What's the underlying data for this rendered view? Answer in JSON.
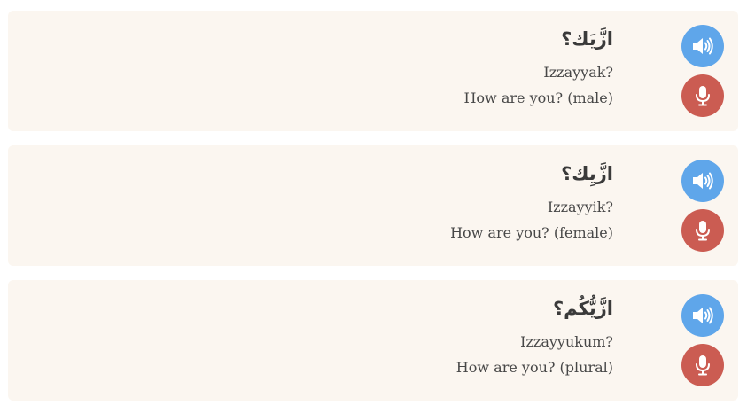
{
  "phrases": [
    {
      "arabic": "ازَّيَك؟",
      "transliteration": "Izzayyak?",
      "english": "How are you? (male)",
      "audio_icon": "speaker-volume-icon",
      "mic_icon": "microphone-icon"
    },
    {
      "arabic": "ازَّيِك؟",
      "transliteration": "Izzayyik?",
      "english": "How are you? (female)",
      "audio_icon": "speaker-volume-icon",
      "mic_icon": "microphone-icon"
    },
    {
      "arabic": "ازَّيُّكُم؟",
      "transliteration": "Izzayyukum?",
      "english": "How are you? (plural)",
      "audio_icon": "speaker-volume-icon",
      "mic_icon": "microphone-icon"
    }
  ],
  "colors": {
    "card_background": "#fbf6f0",
    "audio_button": "#5fa6ea",
    "mic_button": "#cb5c52",
    "text": "#474747"
  }
}
